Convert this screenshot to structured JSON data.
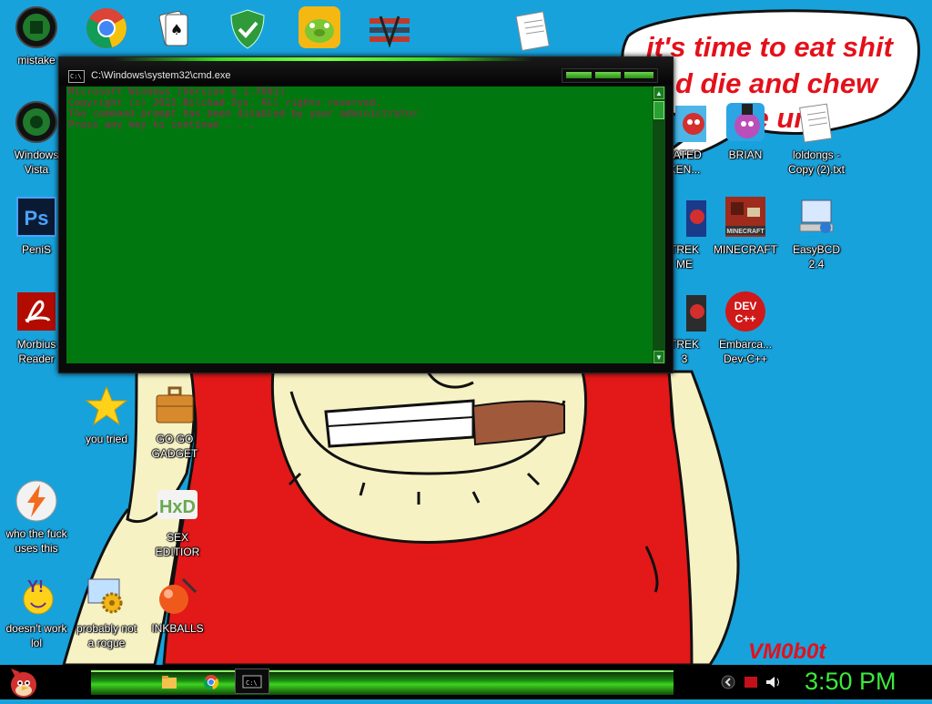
{
  "speech_bubble": {
    "line1": "it's time to eat shit",
    "line2": "d die and chew",
    "line3": "ble   um"
  },
  "watermark": "VM0b0t",
  "cmd_window": {
    "title": "C:\\Windows\\system32\\cmd.exe",
    "lines": [
      "Microsoft Windows [Version 6.1.7601]",
      "Copyright (c) 2012 Bilchad Sys. All rights reserved.",
      "",
      "The command prompt has been disabled by your administrator.",
      "",
      "Press any key to continue . . ."
    ]
  },
  "desktop_icons": [
    {
      "label": "mistake",
      "icon": "green-orb-icon"
    },
    {
      "label": "Windows\nVista",
      "icon": "green-orb-icon"
    },
    {
      "label": "PeniS",
      "icon": "photoshop-icon"
    },
    {
      "label": "Morbius\nReader",
      "icon": "pdf-reader-icon"
    },
    {
      "label": "you tried",
      "icon": "star-icon"
    },
    {
      "label": "GO GO\nGADGET",
      "icon": "briefcase-icon"
    },
    {
      "label": "who the fuck\nuses this",
      "icon": "lightning-icon"
    },
    {
      "label": "SEX\nEDITIOR",
      "icon": "hex-editor-icon"
    },
    {
      "label": "doesn't work\nlol",
      "icon": "yahoo-messenger-icon"
    },
    {
      "label": "probably not\na rogue",
      "icon": "gear-monitor-icon"
    },
    {
      "label": "INKBALLS",
      "icon": "inkball-icon"
    },
    {
      "label": "TATED\nKEN...",
      "icon": "angry-birds-icon"
    },
    {
      "label": "BRIAN",
      "icon": "angry-birds-rio-icon"
    },
    {
      "label": "loldongs -\nCopy (2).txt",
      "icon": "text-file-icon"
    },
    {
      "label": "TREK\nME",
      "icon": "angry-birds-star-icon"
    },
    {
      "label": "MINECRAFT",
      "icon": "minecraft-icon"
    },
    {
      "label": "EasyBCD\n2.4",
      "icon": "easybcd-icon"
    },
    {
      "label": "TREK\n3",
      "icon": "angry-birds-star-icon"
    },
    {
      "label": "Embarca...\nDev-C++",
      "icon": "devcpp-icon"
    }
  ],
  "top_icons": [
    "chrome-icon",
    "solitaire-icon",
    "security-shield-icon",
    "bad-piggies-icon",
    "logo-icon",
    "document-icon"
  ],
  "taskbar": {
    "start": "angry-bird-start-icon",
    "pinned": [
      "folder-icon",
      "chrome-icon",
      "cmd-icon"
    ],
    "tray_icons": [
      "back-icon",
      "flag-icon",
      "volume-icon"
    ],
    "clock": "3:50 PM"
  },
  "colors": {
    "desktop": "#18a2dc",
    "cmd_bg": "#00780f",
    "cmd_text": "#a11d5c",
    "clock": "#3bea3b",
    "bubble_text": "#e4101a"
  }
}
